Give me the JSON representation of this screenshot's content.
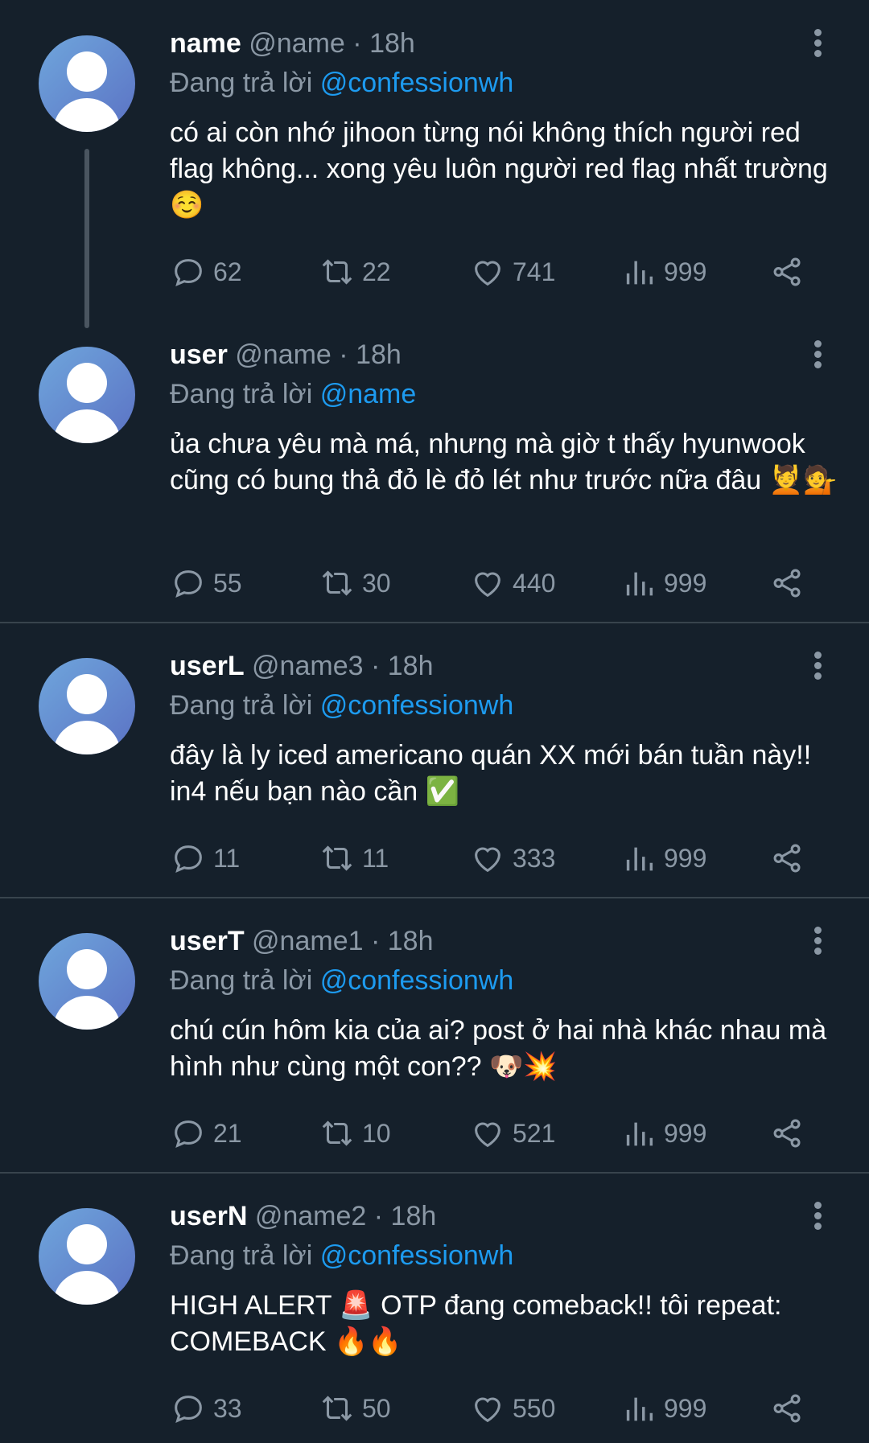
{
  "tweets": [
    {
      "name": "name",
      "handle": "@name",
      "time": "18h",
      "reply_prefix": "Đang trả lời",
      "reply_to": "@confessionwh",
      "text": "có ai còn nhớ jihoon từng nói không thích người red flag không... xong yêu luôn người red flag nhất trường ☺️",
      "replies": "62",
      "retweets": "22",
      "likes": "741",
      "views": "999"
    },
    {
      "name": "user",
      "handle": "@name",
      "time": "18h",
      "reply_prefix": "Đang trả lời",
      "reply_to": "@name",
      "text": "ủa chưa yêu mà má, nhưng mà giờ t thấy hyunwook cũng có bung thả đỏ lè đỏ lét như trước nữa đâu 💆💁",
      "replies": "55",
      "retweets": "30",
      "likes": "440",
      "views": "999"
    },
    {
      "name": "userL",
      "handle": "@name3",
      "time": "18h",
      "reply_prefix": "Đang trả lời",
      "reply_to": "@confessionwh",
      "text": "đây là ly iced americano quán XX mới bán tuần này!! in4 nếu bạn nào cần ✅",
      "replies": "11",
      "retweets": "11",
      "likes": "333",
      "views": "999"
    },
    {
      "name": "userT",
      "handle": "@name1",
      "time": "18h",
      "reply_prefix": "Đang trả lời",
      "reply_to": "@confessionwh",
      "text": "chú cún hôm kia của ai? post ở hai nhà khác nhau mà hình như cùng một con?? 🐶💥",
      "replies": "21",
      "retweets": "10",
      "likes": "521",
      "views": "999"
    },
    {
      "name": "userN",
      "handle": "@name2",
      "time": "18h",
      "reply_prefix": "Đang trả lời",
      "reply_to": "@confessionwh",
      "text": "HIGH ALERT 🚨 OTP đang comeback!! tôi repeat: COMEBACK 🔥🔥",
      "replies": "33",
      "retweets": "50",
      "likes": "550",
      "views": "999"
    }
  ],
  "meta_separator": " · ",
  "colors": {
    "background": "#15202b",
    "muted": "#8b98a5",
    "accent": "#1d9bf0",
    "divider": "#38444d"
  },
  "icons": [
    "reply-icon",
    "retweet-icon",
    "like-icon",
    "views-icon",
    "share-icon",
    "more-icon"
  ]
}
